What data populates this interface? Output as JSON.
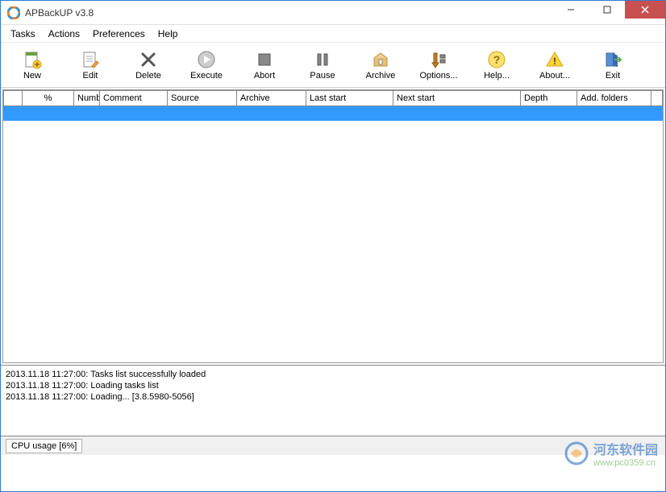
{
  "window": {
    "title": "APBackUP v3.8"
  },
  "menu": {
    "items": [
      "Tasks",
      "Actions",
      "Preferences",
      "Help"
    ]
  },
  "toolbar": {
    "new": "New",
    "edit": "Edit",
    "delete": "Delete",
    "execute": "Execute",
    "abort": "Abort",
    "pause": "Pause",
    "archive": "Archive",
    "options": "Options...",
    "help": "Help...",
    "about": "About...",
    "exit": "Exit"
  },
  "columns": {
    "c0": "",
    "c1": "%",
    "c2": "Numb",
    "c3": "Comment",
    "c4": "Source",
    "c5": "Archive",
    "c6": "Last start",
    "c7": "Next start",
    "c8": "Depth",
    "c9": "Add. folders",
    "c10": ""
  },
  "log": {
    "l0": "2013.11.18 11:27:00: Tasks list successfully loaded",
    "l1": "2013.11.18 11:27:00: Loading tasks list",
    "l2": "2013.11.18 11:27:00: Loading... [3.8.5980-5056]"
  },
  "status": {
    "cpu": "CPU usage [6%]"
  },
  "watermark": {
    "text": "河东软件园",
    "url": "www.pc0359.cn"
  }
}
